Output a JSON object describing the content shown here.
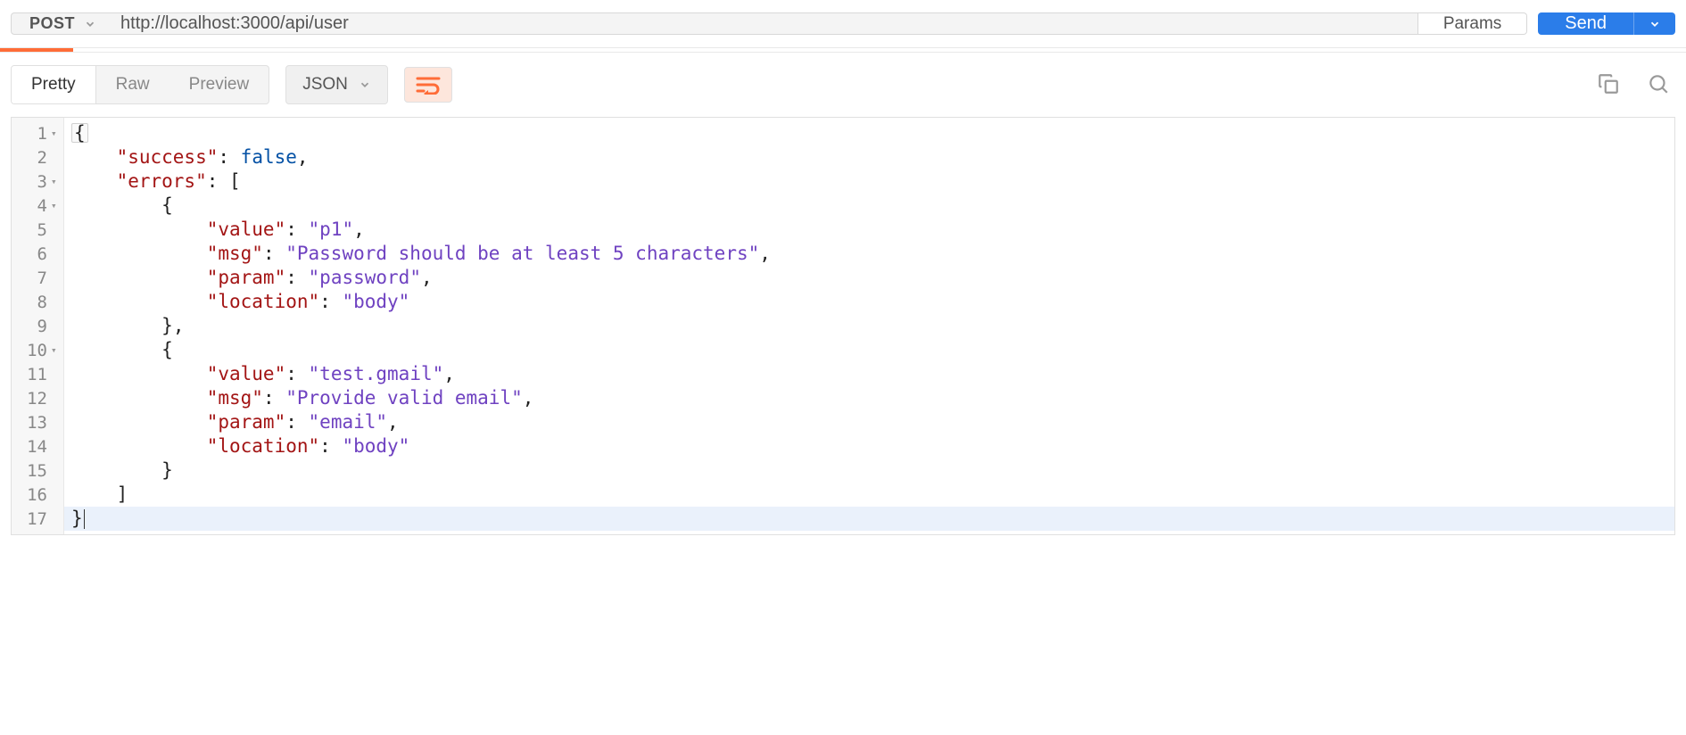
{
  "request": {
    "method": "POST",
    "url": "http://localhost:3000/api/user",
    "params_label": "Params",
    "send_label": "Send"
  },
  "response_toolbar": {
    "tabs": {
      "pretty": "Pretty",
      "raw": "Raw",
      "preview": "Preview"
    },
    "format": "JSON"
  },
  "code": {
    "lines": [
      {
        "n": "1",
        "fold": true
      },
      {
        "n": "2",
        "fold": false
      },
      {
        "n": "3",
        "fold": true
      },
      {
        "n": "4",
        "fold": true
      },
      {
        "n": "5",
        "fold": false
      },
      {
        "n": "6",
        "fold": false
      },
      {
        "n": "7",
        "fold": false
      },
      {
        "n": "8",
        "fold": false
      },
      {
        "n": "9",
        "fold": false
      },
      {
        "n": "10",
        "fold": true
      },
      {
        "n": "11",
        "fold": false
      },
      {
        "n": "12",
        "fold": false
      },
      {
        "n": "13",
        "fold": false
      },
      {
        "n": "14",
        "fold": false
      },
      {
        "n": "15",
        "fold": false
      },
      {
        "n": "16",
        "fold": false
      },
      {
        "n": "17",
        "fold": false
      }
    ]
  },
  "response_body": {
    "success": false,
    "errors": [
      {
        "value": "p1",
        "msg": "Password should be at least 5 characters",
        "param": "password",
        "location": "body"
      },
      {
        "value": "test.gmail",
        "msg": "Provide valid email",
        "param": "email",
        "location": "body"
      }
    ]
  },
  "tokens": {
    "l1": {
      "brace": "{"
    },
    "l2": {
      "k": "\"success\"",
      "c": ":",
      "v": " false",
      "comma": ","
    },
    "l3": {
      "k": "\"errors\"",
      "c": ":",
      "b": " ["
    },
    "l4": {
      "brace": "{"
    },
    "l5": {
      "k": "\"value\"",
      "c": ":",
      "v": " \"p1\"",
      "comma": ","
    },
    "l6": {
      "k": "\"msg\"",
      "c": ":",
      "v": " \"Password should be at least 5 characters\"",
      "comma": ","
    },
    "l7": {
      "k": "\"param\"",
      "c": ":",
      "v": " \"password\"",
      "comma": ","
    },
    "l8": {
      "k": "\"location\"",
      "c": ":",
      "v": " \"body\""
    },
    "l9": {
      "brace": "}",
      "comma": ","
    },
    "l10": {
      "brace": "{"
    },
    "l11": {
      "k": "\"value\"",
      "c": ":",
      "v": " \"test.gmail\"",
      "comma": ","
    },
    "l12": {
      "k": "\"msg\"",
      "c": ":",
      "v": " \"Provide valid email\"",
      "comma": ","
    },
    "l13": {
      "k": "\"param\"",
      "c": ":",
      "v": " \"email\"",
      "comma": ","
    },
    "l14": {
      "k": "\"location\"",
      "c": ":",
      "v": " \"body\""
    },
    "l15": {
      "brace": "}"
    },
    "l16": {
      "brace": "]"
    },
    "l17": {
      "brace": "}"
    }
  }
}
